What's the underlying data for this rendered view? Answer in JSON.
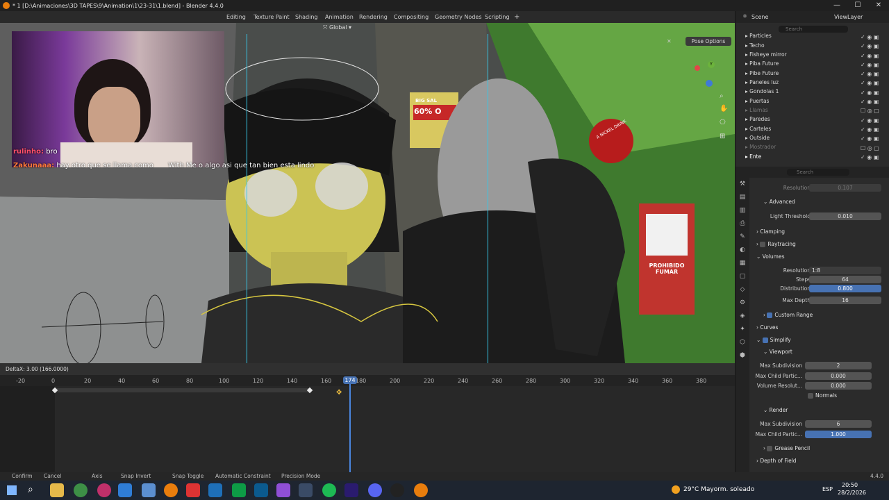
{
  "window": {
    "title": "* 1 [D:\\Animaciones\\3D TAPES\\9\\Animation\\1\\23-31\\1.blend] - Blender 4.4.0",
    "min": "—",
    "max": "☐",
    "close": "✕"
  },
  "workspaces": [
    "Editing",
    "Texture Paint",
    "Shading",
    "Animation",
    "Rendering",
    "Compositing",
    "Geometry Nodes",
    "Scripting"
  ],
  "add_tab": "+",
  "scene": {
    "scene_label": "Scene",
    "viewlayer_label": "ViewLayer"
  },
  "viewport": {
    "orientation": "Global",
    "pose_options": "Pose Options",
    "gizmo_x": "X",
    "gizmo_y": "Y",
    "gizmo_z": "Z"
  },
  "chat": {
    "msg1_user": "rulinho:",
    "msg1_text": "bro",
    "msg2_user": "Zakunaaa:",
    "msg2_text": "hay otro que se llama como",
    "msg2_text2": "With Me o algo asi que tan bien esta lindo"
  },
  "poster_big": "BIG SAL",
  "poster_pct": "60% O",
  "sign_text": "PROHIBIDO FUMAR",
  "cola_text": "A NICKEL DRINK",
  "timeline": {
    "delta": "DeltaX: 3.00 (166.0000)",
    "current_frame": "174",
    "frames": [
      "-20",
      "0",
      "20",
      "40",
      "60",
      "80",
      "100",
      "120",
      "140",
      "160",
      "180",
      "200",
      "220",
      "240",
      "260",
      "280",
      "300",
      "320",
      "340",
      "360",
      "380"
    ]
  },
  "statusbar": {
    "confirm": "Confirm",
    "cancel": "Cancel",
    "axis": "Axis",
    "snap_invert": "Snap Invert",
    "snap_toggle": "Snap Toggle",
    "auto_constraint": "Automatic Constraint",
    "precision": "Precision Mode",
    "version": "4.4.0"
  },
  "outliner": {
    "search_placeholder": "Search",
    "items": [
      "Particles",
      "Techo",
      "Fisheye mirror",
      "Piba Future",
      "Pibe Future",
      "Paneles luz",
      "Gondolas 1",
      "Puertas",
      "Llamas",
      "Paredes",
      "Carteles",
      "Outside",
      "Mostrador",
      "Ente"
    ]
  },
  "properties": {
    "search_placeholder": "Search",
    "resolution_label": "Resolution",
    "resolution_value": "0.107",
    "advanced": "Advanced",
    "light_threshold_label": "Light Threshold",
    "light_threshold_value": "0.010",
    "clamping": "Clamping",
    "raytracing": "Raytracing",
    "volumes": "Volumes",
    "vol_resolution_label": "Resolution",
    "vol_resolution_value": "1:8",
    "steps_label": "Steps",
    "steps_value": "64",
    "distribution_label": "Distribution",
    "distribution_value": "0.800",
    "max_depth_label": "Max Depth",
    "max_depth_value": "16",
    "custom_range": "Custom Range",
    "curves": "Curves",
    "simplify": "Simplify",
    "viewport": "Viewport",
    "max_subdiv_label": "Max Subdivision",
    "max_subdiv_value": "2",
    "max_child_label": "Max Child Partic...",
    "max_child_value": "0.000",
    "vol_res_label": "Volume Resolut...",
    "vol_res_value": "0.000",
    "normals": "Normals",
    "render": "Render",
    "r_max_subdiv_label": "Max Subdivision",
    "r_max_subdiv_value": "6",
    "r_max_child_label": "Max Child Partic...",
    "r_max_child_value": "1.000",
    "grease_pencil": "Grease Pencil",
    "dof": "Depth of Field"
  },
  "taskbar": {
    "weather": "29°C  Mayorm. soleado",
    "lang": "ESP",
    "time": "20:50",
    "date": "28/2/2026"
  },
  "colors": {
    "accent": "#4772b3",
    "blender_orange": "#e87d0d",
    "cyan": "#37c7e6"
  }
}
